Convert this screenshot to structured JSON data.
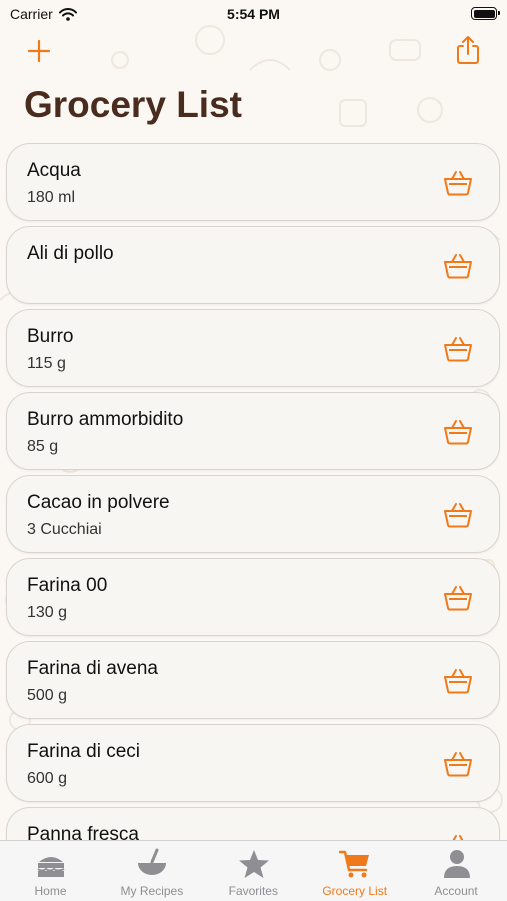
{
  "status_bar": {
    "carrier": "Carrier",
    "time": "5:54 PM"
  },
  "nav": {
    "add_icon": "plus-icon",
    "share_icon": "share-icon"
  },
  "page": {
    "title": "Grocery List"
  },
  "colors": {
    "accent": "#f07a1a",
    "title": "#4a2c1e",
    "inactive": "#8e8e93"
  },
  "items": [
    {
      "name": "Acqua",
      "qty": "180 ml"
    },
    {
      "name": "Ali di pollo",
      "qty": ""
    },
    {
      "name": "Burro",
      "qty": "115 g"
    },
    {
      "name": "Burro ammorbidito",
      "qty": "85 g"
    },
    {
      "name": "Cacao in polvere",
      "qty": "3 Cucchiai"
    },
    {
      "name": "Farina 00",
      "qty": "130 g"
    },
    {
      "name": "Farina di avena",
      "qty": "500 g"
    },
    {
      "name": "Farina di ceci",
      "qty": "600 g"
    },
    {
      "name": "Panna fresca",
      "qty": ""
    }
  ],
  "tabs": [
    {
      "label": "Home",
      "icon": "cake-icon"
    },
    {
      "label": "My Recipes",
      "icon": "mixing-bowl-icon"
    },
    {
      "label": "Favorites",
      "icon": "star-icon"
    },
    {
      "label": "Grocery List",
      "icon": "cart-icon",
      "active": true
    },
    {
      "label": "Account",
      "icon": "person-icon"
    }
  ]
}
